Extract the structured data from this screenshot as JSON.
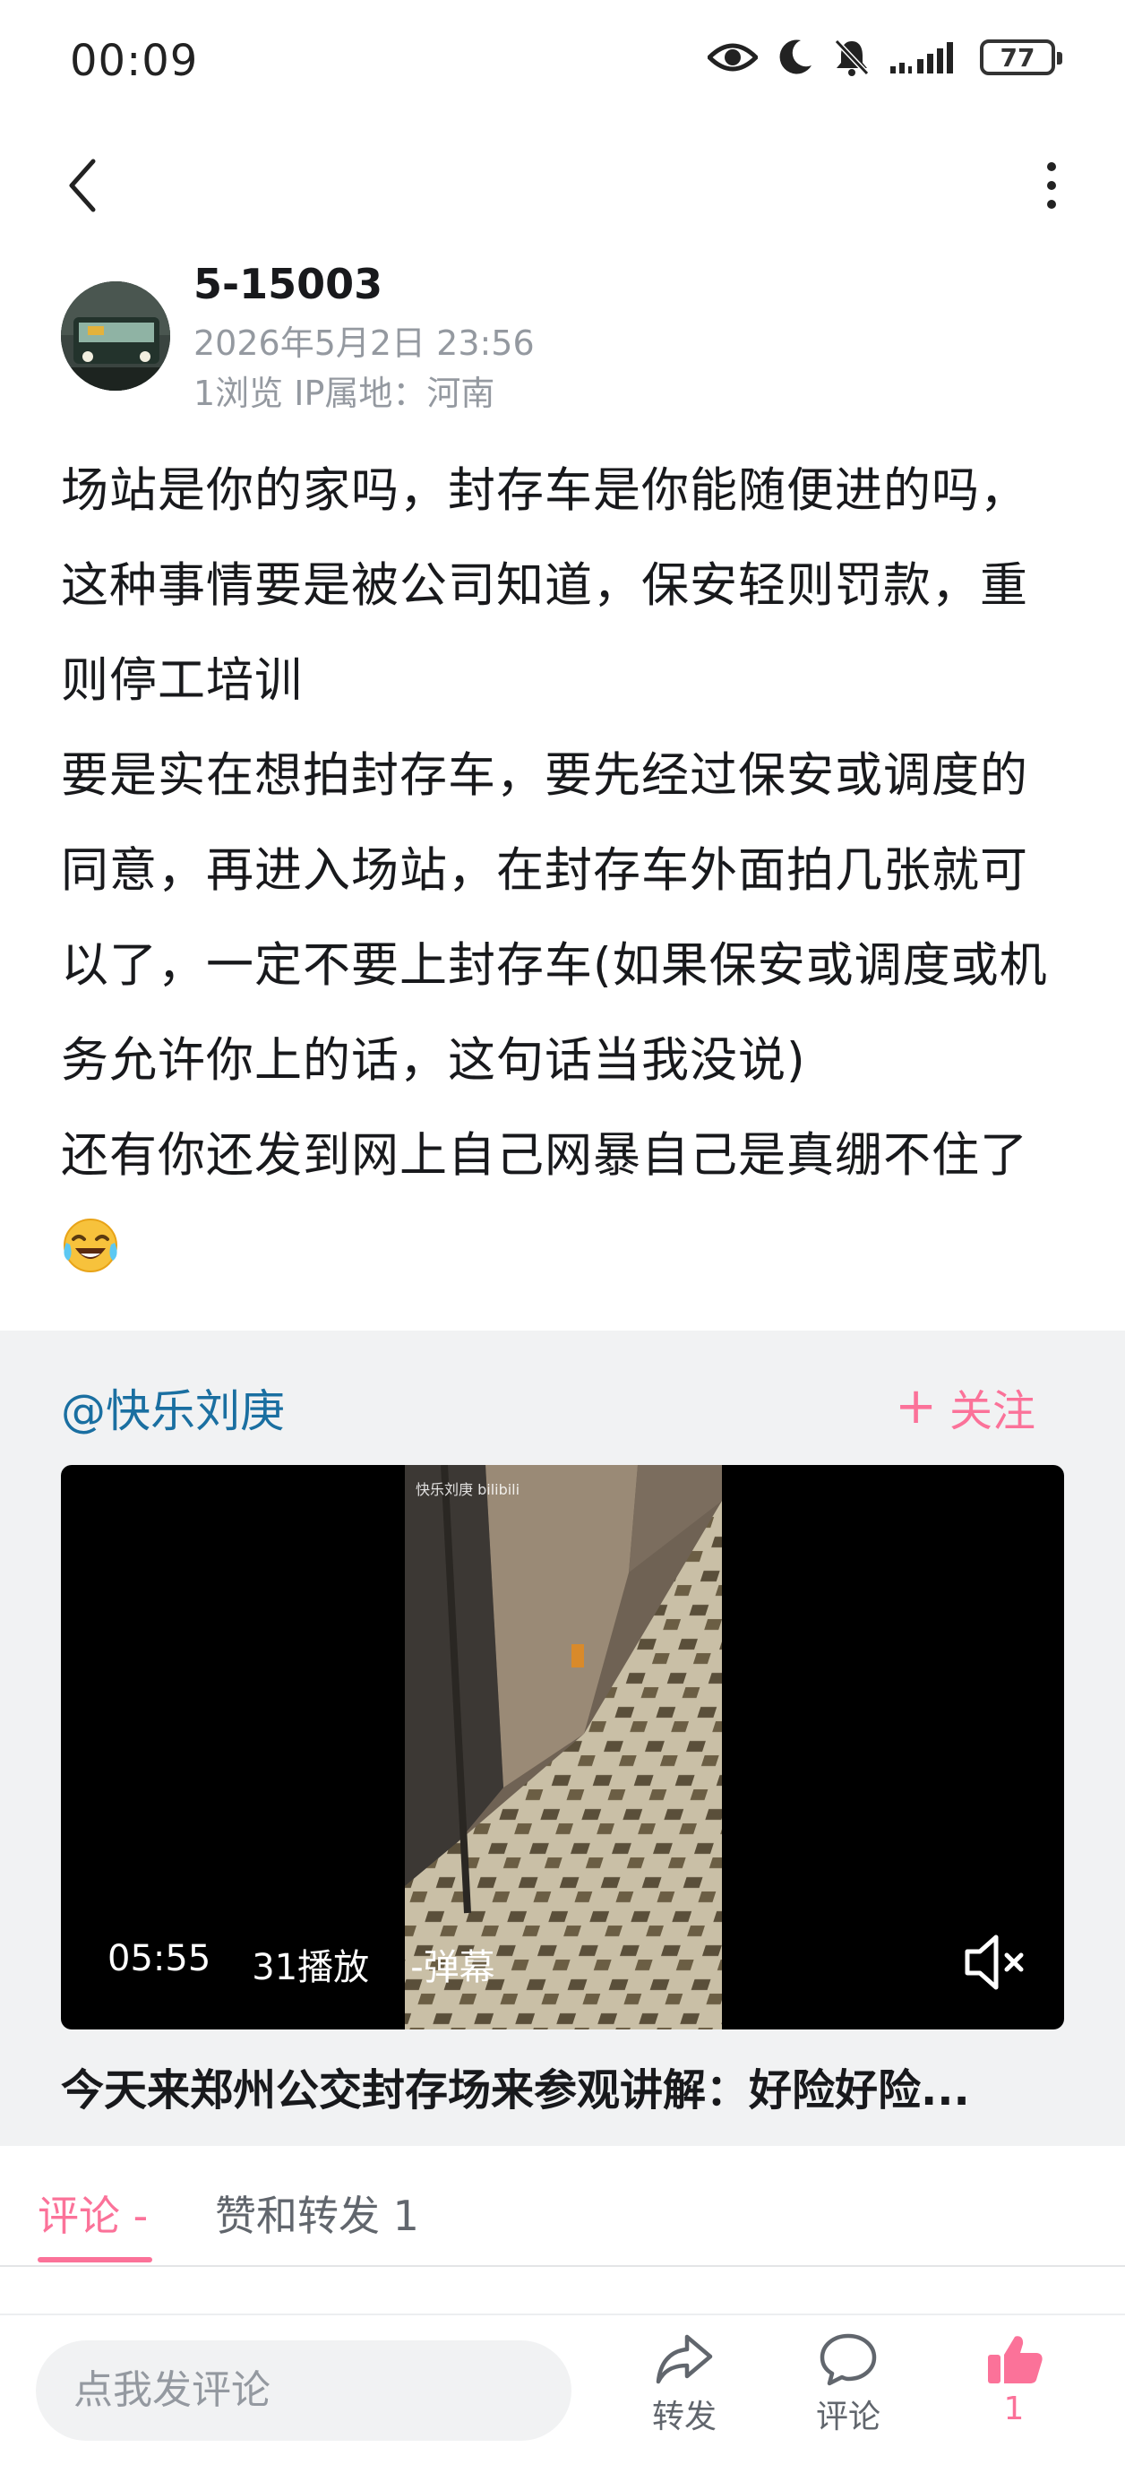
{
  "status_bar": {
    "time": "00:09",
    "battery": "77",
    "icons": [
      "eye-icon",
      "moon-icon",
      "bell-off-icon",
      "signal-icon",
      "battery-icon"
    ]
  },
  "nav": {
    "back_icon": "chevron-left-icon",
    "more_icon": "more-vertical-icon"
  },
  "post": {
    "author": "5-15003",
    "time": "2026年5月2日 23:56",
    "meta": "1浏览  IP属地：河南",
    "lines": [
      "场站是你的家吗，封存车是你能随便进的吗，这种事情要是被公司知道，保安轻则罚款，重则停工培训",
      "要是实在想拍封存车，要先经过保安或调度的同意，再进入场站，在封存车外面拍几张就可以了，一定不要上封存车(如果保安或调度或机务允许你上的话，这句话当我没说)",
      "还有你还发到网上自己网暴自己是真绷不住了"
    ],
    "emoji": "laughing-tears-emoji"
  },
  "shared": {
    "author": "@快乐刘庚",
    "follow_label": "关注",
    "video": {
      "duration": "05:55",
      "plays": "31播放",
      "danmaku": "-弹幕",
      "watermark": "快乐刘庚 bilibili"
    },
    "title": "今天来郑州公交封存场来参观讲解：好险好险..."
  },
  "tabs": {
    "comments": "评论 -",
    "likes_reposts": "赞和转发 1"
  },
  "bottom_bar": {
    "input_placeholder": "点我发评论",
    "share_label": "转发",
    "comment_label": "评论",
    "like_count": "1"
  },
  "colors": {
    "accent": "#fb7299",
    "link": "#1a6fa1",
    "muted": "#9499a0",
    "card_bg": "#f1f2f3"
  }
}
